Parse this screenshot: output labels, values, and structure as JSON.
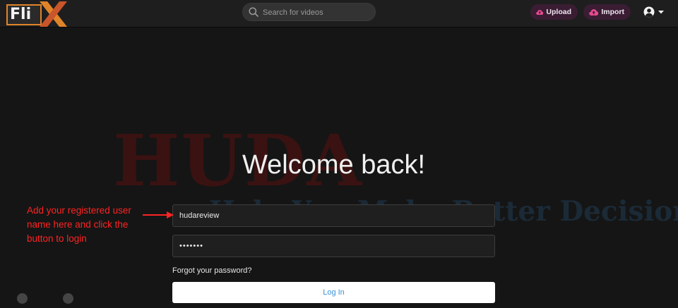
{
  "header": {
    "logo_text": "Fli",
    "search": {
      "placeholder": "Search for videos"
    },
    "upload_label": "Upload",
    "import_label": "Import"
  },
  "watermark": {
    "brand": "HUDA",
    "tagline": "Help You Make Better Decisions"
  },
  "login": {
    "title": "Welcome back!",
    "username_value": "hudareview",
    "password_value": "•••••••",
    "forgot_label": "Forgot your password?",
    "submit_label": "Log In"
  },
  "annotation": {
    "text": "Add your registered user name here and click the button to login"
  },
  "colors": {
    "background": "#151515",
    "header": "#1e1e1e",
    "accent_pink": "#e64b8f",
    "logo_orange": "#e0842a",
    "annotation_red": "#ff2323",
    "link_blue": "#3b8fd6"
  }
}
